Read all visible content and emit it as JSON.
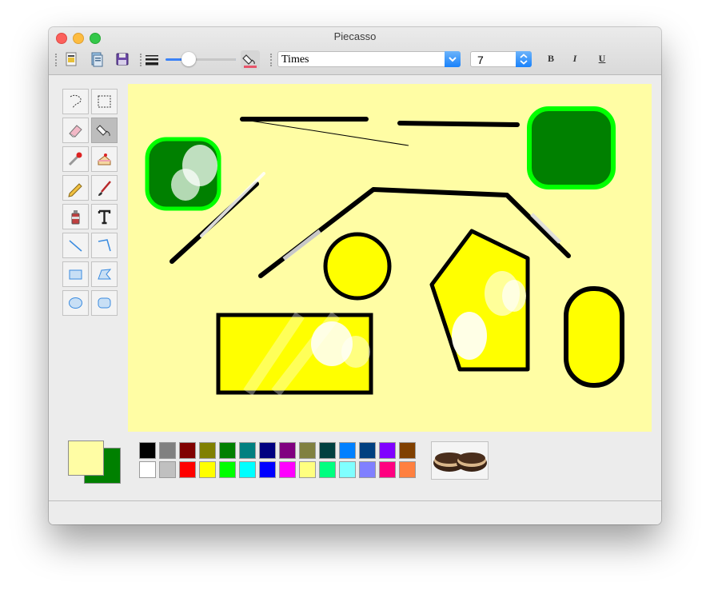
{
  "window": {
    "title": "Piecasso"
  },
  "toolbar": {
    "font_family": "Times",
    "font_size": "7",
    "bold_label": "B",
    "italic_label": "I",
    "underline_label": "U",
    "line_width_slider_fraction": 0.4
  },
  "tools": [
    "lasso-select",
    "rect-select",
    "eraser",
    "fill-bucket",
    "eyedropper",
    "cake-stamp",
    "pencil",
    "brush",
    "spray-can",
    "text",
    "line",
    "polyline",
    "rectangle",
    "polygon",
    "ellipse",
    "rounded-rect"
  ],
  "active_tool": "fill-bucket",
  "colors": {
    "foreground": "#fffda4",
    "background": "#008000",
    "canvas": "#fffda4",
    "palette_row1": [
      "#000000",
      "#808080",
      "#800000",
      "#808000",
      "#008000",
      "#008080",
      "#000080",
      "#800080",
      "#808040",
      "#004040",
      "#0080ff",
      "#004080",
      "#8000ff",
      "#804000"
    ],
    "palette_row2": [
      "#ffffff",
      "#c0c0c0",
      "#ff0000",
      "#ffff00",
      "#00ff00",
      "#00ffff",
      "#0000ff",
      "#ff00ff",
      "#ffff80",
      "#00ff80",
      "#80ffff",
      "#8080ff",
      "#ff0080",
      "#ff8040"
    ]
  }
}
